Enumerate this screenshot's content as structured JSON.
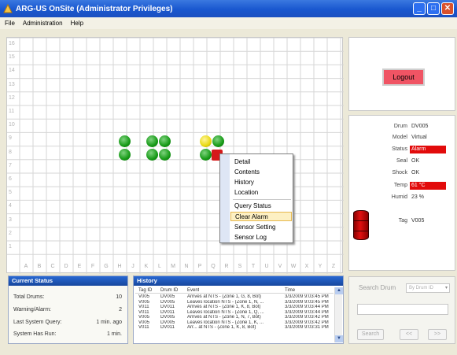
{
  "window": {
    "title": "ARG-US OnSite (Administrator Privileges)"
  },
  "menu": {
    "items": [
      "File",
      "Administration",
      "Help"
    ]
  },
  "grid": {
    "row_labels": [
      "16",
      "15",
      "14",
      "13",
      "12",
      "11",
      "10",
      "9",
      "8",
      "7",
      "6",
      "5",
      "4",
      "3",
      "2",
      "1"
    ],
    "column_labels": [
      "A",
      "B",
      "C",
      "D",
      "E",
      "F",
      "G",
      "H",
      "J",
      "K",
      "L",
      "M",
      "N",
      "P",
      "Q",
      "R",
      "S",
      "T",
      "U",
      "V",
      "W",
      "X",
      "Y",
      "Z"
    ]
  },
  "drums": [
    {
      "id": "green"
    },
    {
      "id": "green"
    },
    {
      "id": "green"
    },
    {
      "id": "green"
    },
    {
      "id": "green"
    },
    {
      "id": "green"
    },
    {
      "id": "yellow"
    },
    {
      "id": "green"
    },
    {
      "id": "green"
    },
    {
      "id": "red"
    }
  ],
  "context_menu": {
    "items": [
      "Detail",
      "Contents",
      "History",
      "Location",
      "Query Status",
      "Clear Alarm",
      "Sensor Setting",
      "Sensor Log"
    ],
    "highlighted": "Clear Alarm"
  },
  "logout": {
    "label": "Logout",
    "color": "#f05464"
  },
  "drum_info": {
    "drum_label": "Drum",
    "drum_value": "DV005",
    "model_label": "Model",
    "model_value": "Virtual",
    "status_label": "Status",
    "status_value": "Alarm",
    "seal_label": "Seal",
    "seal_value": "OK",
    "shock_label": "Shock",
    "shock_value": "OK",
    "temp_label": "Temp",
    "temp_value": "61 °C",
    "humid_label": "Humid",
    "humid_value": "23 %",
    "tag_label": "Tag",
    "tag_value": "V005",
    "alert_color": "#e20b0b"
  },
  "current_status": {
    "title": "Current Status",
    "rows": [
      {
        "label": "Total Drums:",
        "value": "10"
      },
      {
        "label": "Warning/Alarm:",
        "value": "2"
      },
      {
        "label": "Last System Query:",
        "value": "1 min. ago"
      },
      {
        "label": "System Has Run:",
        "value": "1 min."
      }
    ]
  },
  "history": {
    "title": "History",
    "columns": [
      "Tag ID",
      "Drum ID",
      "Event",
      "Time"
    ],
    "rows": [
      [
        "V005",
        "DV005",
        "Arrives at NTS - (Zone 1, G, 8, Bot)",
        "3/3/2009 9:03:45 PM"
      ],
      [
        "V005",
        "DV005",
        "Leaves location NTS - (Zone 1, N, ...",
        "3/3/2009 9:03:45 PM"
      ],
      [
        "V011",
        "DV011",
        "Arrives at NTS - (Zone 1, K, 8, Bot)",
        "3/3/2009 9:03:44 PM"
      ],
      [
        "V011",
        "DV011",
        "Leaves location NTS - (Zone 1, Q, ...",
        "3/3/2009 9:03:44 PM"
      ],
      [
        "V005",
        "DV005",
        "Arrives at NTS - (Zone 1, N, 7, Bot)",
        "3/3/2009 9:03:42 PM"
      ],
      [
        "V005",
        "DV005",
        "Leaves location NTS - (Zone 1, K, ...",
        "3/3/2009 9:03:42 PM"
      ],
      [
        "V011",
        "DV011",
        "Arr... at NTS - (Zone 1, K, 8, Bot)",
        "3/3/2009 9:03:31 PM"
      ]
    ]
  },
  "search": {
    "label": "Search Drum",
    "select_value": "By Drum ID",
    "search_button": "Search",
    "prev_button": "<<",
    "next_button": ">>"
  }
}
